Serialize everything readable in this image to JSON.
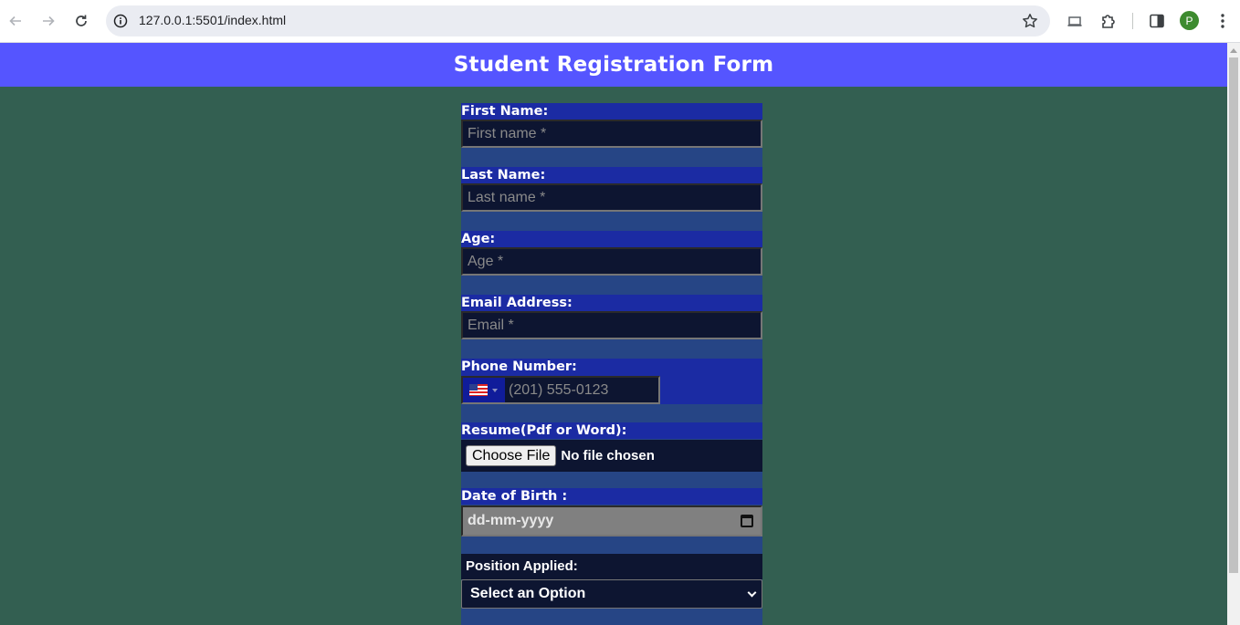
{
  "browser": {
    "url": "127.0.0.1:5501/index.html",
    "profile_initial": "P",
    "icons": [
      "back-arrow-icon",
      "forward-arrow-icon",
      "reload-icon",
      "site-info-icon",
      "bookmark-star-icon",
      "cast-icon",
      "extensions-icon",
      "side-panel-icon",
      "profile-avatar",
      "more-menu-icon"
    ]
  },
  "page": {
    "title": "Student Registration Form",
    "colors": {
      "background": "#335f51",
      "header": "#5555ff",
      "form_background": "#264585",
      "label_background": "#1b2ba3",
      "input_background": "#0d1531"
    }
  },
  "form": {
    "first_name": {
      "label": "First Name:",
      "placeholder": "First name *",
      "value": ""
    },
    "last_name": {
      "label": "Last Name:",
      "placeholder": "Last name *",
      "value": ""
    },
    "age": {
      "label": "Age:",
      "placeholder": "Age *",
      "value": ""
    },
    "email": {
      "label": "Email Address:",
      "placeholder": "Email *",
      "value": ""
    },
    "phone": {
      "label": "Phone Number:",
      "placeholder": "(201) 555-0123",
      "country_flag": "US",
      "value": ""
    },
    "resume": {
      "label": "Resume(Pdf or Word):",
      "button_label": "Choose File",
      "status": "No file chosen"
    },
    "dob": {
      "label": "Date of Birth :",
      "placeholder": "dd-mm-yyyy"
    },
    "position": {
      "label": "Position Applied:",
      "selected": "Select an Option"
    }
  }
}
